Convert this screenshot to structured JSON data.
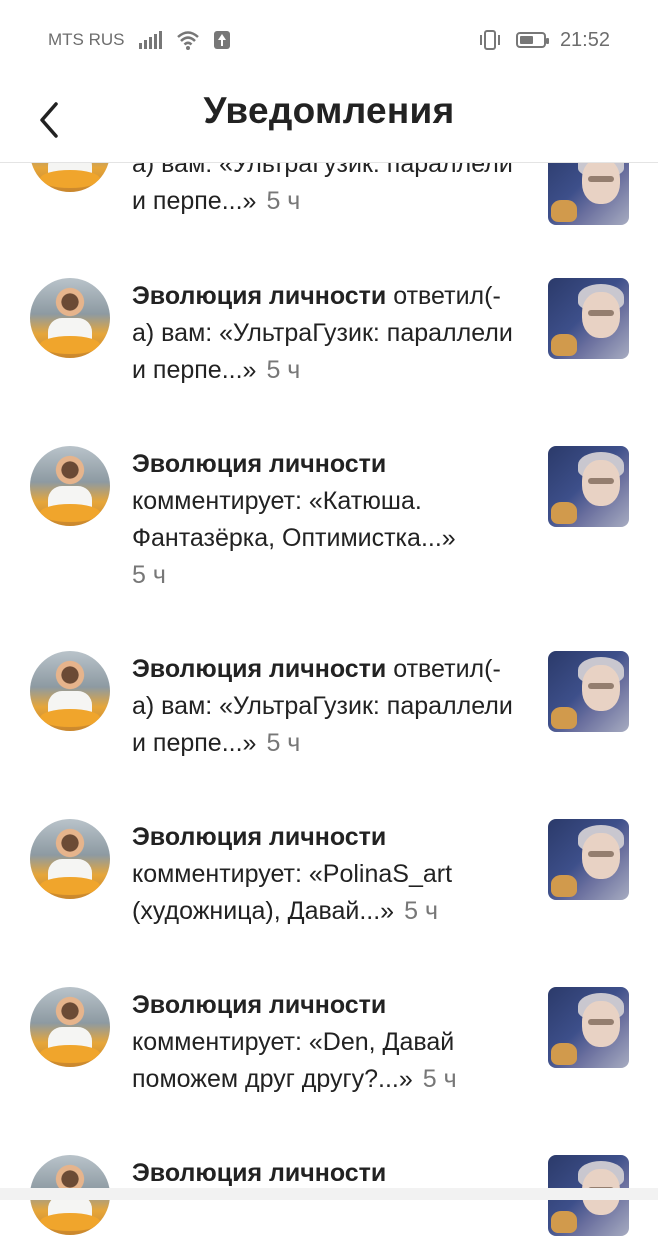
{
  "status_bar": {
    "carrier": "MTS RUS",
    "time": "21:52"
  },
  "header": {
    "title": "Уведомления"
  },
  "notifications": [
    {
      "author": "",
      "action": "а) вам: «УльтраГузик: параллели и перпе...»",
      "time": "5 ч",
      "partial": true
    },
    {
      "author": "Эволюция личности",
      "action": "ответил(-а) вам: «УльтраГузик: параллели и перпе...»",
      "time": "5 ч"
    },
    {
      "author": "Эволюция личности",
      "action": "комментирует: «Катюша. Фантазёрка, Оптимистка...»",
      "time": "5 ч"
    },
    {
      "author": "Эволюция личности",
      "action": "ответил(-а) вам: «УльтраГузик: параллели и перпе...»",
      "time": "5 ч"
    },
    {
      "author": "Эволюция личности",
      "action": "комментирует: «PolinaS_art (художница), Давай...»",
      "time": "5 ч"
    },
    {
      "author": "Эволюция личности",
      "action": "комментирует: «Den, Давай поможем друг другу?...»",
      "time": "5 ч"
    },
    {
      "author": "Эволюция личности",
      "action": "",
      "time": ""
    }
  ]
}
